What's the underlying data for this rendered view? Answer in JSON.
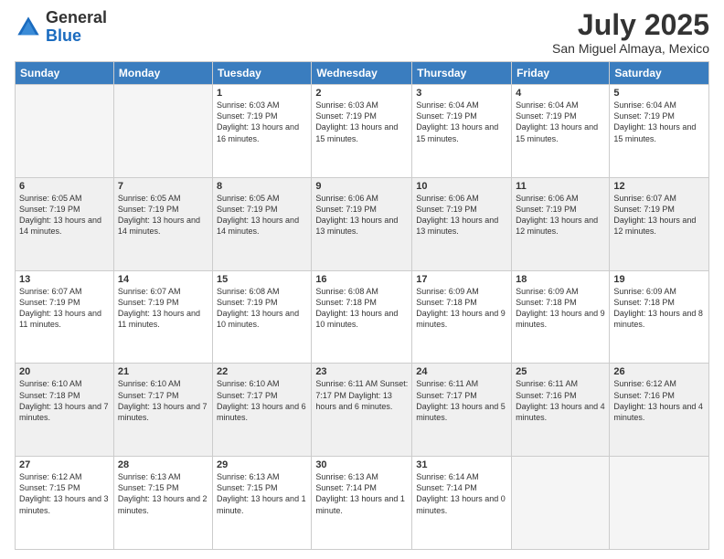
{
  "header": {
    "logo_general": "General",
    "logo_blue": "Blue",
    "month": "July 2025",
    "location": "San Miguel Almaya, Mexico"
  },
  "days_of_week": [
    "Sunday",
    "Monday",
    "Tuesday",
    "Wednesday",
    "Thursday",
    "Friday",
    "Saturday"
  ],
  "weeks": [
    {
      "shade": false,
      "days": [
        {
          "num": "",
          "info": ""
        },
        {
          "num": "",
          "info": ""
        },
        {
          "num": "1",
          "info": "Sunrise: 6:03 AM\nSunset: 7:19 PM\nDaylight: 13 hours\nand 16 minutes."
        },
        {
          "num": "2",
          "info": "Sunrise: 6:03 AM\nSunset: 7:19 PM\nDaylight: 13 hours\nand 15 minutes."
        },
        {
          "num": "3",
          "info": "Sunrise: 6:04 AM\nSunset: 7:19 PM\nDaylight: 13 hours\nand 15 minutes."
        },
        {
          "num": "4",
          "info": "Sunrise: 6:04 AM\nSunset: 7:19 PM\nDaylight: 13 hours\nand 15 minutes."
        },
        {
          "num": "5",
          "info": "Sunrise: 6:04 AM\nSunset: 7:19 PM\nDaylight: 13 hours\nand 15 minutes."
        }
      ]
    },
    {
      "shade": true,
      "days": [
        {
          "num": "6",
          "info": "Sunrise: 6:05 AM\nSunset: 7:19 PM\nDaylight: 13 hours\nand 14 minutes."
        },
        {
          "num": "7",
          "info": "Sunrise: 6:05 AM\nSunset: 7:19 PM\nDaylight: 13 hours\nand 14 minutes."
        },
        {
          "num": "8",
          "info": "Sunrise: 6:05 AM\nSunset: 7:19 PM\nDaylight: 13 hours\nand 14 minutes."
        },
        {
          "num": "9",
          "info": "Sunrise: 6:06 AM\nSunset: 7:19 PM\nDaylight: 13 hours\nand 13 minutes."
        },
        {
          "num": "10",
          "info": "Sunrise: 6:06 AM\nSunset: 7:19 PM\nDaylight: 13 hours\nand 13 minutes."
        },
        {
          "num": "11",
          "info": "Sunrise: 6:06 AM\nSunset: 7:19 PM\nDaylight: 13 hours\nand 12 minutes."
        },
        {
          "num": "12",
          "info": "Sunrise: 6:07 AM\nSunset: 7:19 PM\nDaylight: 13 hours\nand 12 minutes."
        }
      ]
    },
    {
      "shade": false,
      "days": [
        {
          "num": "13",
          "info": "Sunrise: 6:07 AM\nSunset: 7:19 PM\nDaylight: 13 hours\nand 11 minutes."
        },
        {
          "num": "14",
          "info": "Sunrise: 6:07 AM\nSunset: 7:19 PM\nDaylight: 13 hours\nand 11 minutes."
        },
        {
          "num": "15",
          "info": "Sunrise: 6:08 AM\nSunset: 7:19 PM\nDaylight: 13 hours\nand 10 minutes."
        },
        {
          "num": "16",
          "info": "Sunrise: 6:08 AM\nSunset: 7:18 PM\nDaylight: 13 hours\nand 10 minutes."
        },
        {
          "num": "17",
          "info": "Sunrise: 6:09 AM\nSunset: 7:18 PM\nDaylight: 13 hours\nand 9 minutes."
        },
        {
          "num": "18",
          "info": "Sunrise: 6:09 AM\nSunset: 7:18 PM\nDaylight: 13 hours\nand 9 minutes."
        },
        {
          "num": "19",
          "info": "Sunrise: 6:09 AM\nSunset: 7:18 PM\nDaylight: 13 hours\nand 8 minutes."
        }
      ]
    },
    {
      "shade": true,
      "days": [
        {
          "num": "20",
          "info": "Sunrise: 6:10 AM\nSunset: 7:18 PM\nDaylight: 13 hours\nand 7 minutes."
        },
        {
          "num": "21",
          "info": "Sunrise: 6:10 AM\nSunset: 7:17 PM\nDaylight: 13 hours\nand 7 minutes."
        },
        {
          "num": "22",
          "info": "Sunrise: 6:10 AM\nSunset: 7:17 PM\nDaylight: 13 hours\nand 6 minutes."
        },
        {
          "num": "23",
          "info": "Sunrise: 6:11 AM\nSunset: 7:17 PM\nDaylight: 13 hours\nand 6 minutes."
        },
        {
          "num": "24",
          "info": "Sunrise: 6:11 AM\nSunset: 7:17 PM\nDaylight: 13 hours\nand 5 minutes."
        },
        {
          "num": "25",
          "info": "Sunrise: 6:11 AM\nSunset: 7:16 PM\nDaylight: 13 hours\nand 4 minutes."
        },
        {
          "num": "26",
          "info": "Sunrise: 6:12 AM\nSunset: 7:16 PM\nDaylight: 13 hours\nand 4 minutes."
        }
      ]
    },
    {
      "shade": false,
      "days": [
        {
          "num": "27",
          "info": "Sunrise: 6:12 AM\nSunset: 7:15 PM\nDaylight: 13 hours\nand 3 minutes."
        },
        {
          "num": "28",
          "info": "Sunrise: 6:13 AM\nSunset: 7:15 PM\nDaylight: 13 hours\nand 2 minutes."
        },
        {
          "num": "29",
          "info": "Sunrise: 6:13 AM\nSunset: 7:15 PM\nDaylight: 13 hours\nand 1 minute."
        },
        {
          "num": "30",
          "info": "Sunrise: 6:13 AM\nSunset: 7:14 PM\nDaylight: 13 hours\nand 1 minute."
        },
        {
          "num": "31",
          "info": "Sunrise: 6:14 AM\nSunset: 7:14 PM\nDaylight: 13 hours\nand 0 minutes."
        },
        {
          "num": "",
          "info": ""
        },
        {
          "num": "",
          "info": ""
        }
      ]
    }
  ]
}
